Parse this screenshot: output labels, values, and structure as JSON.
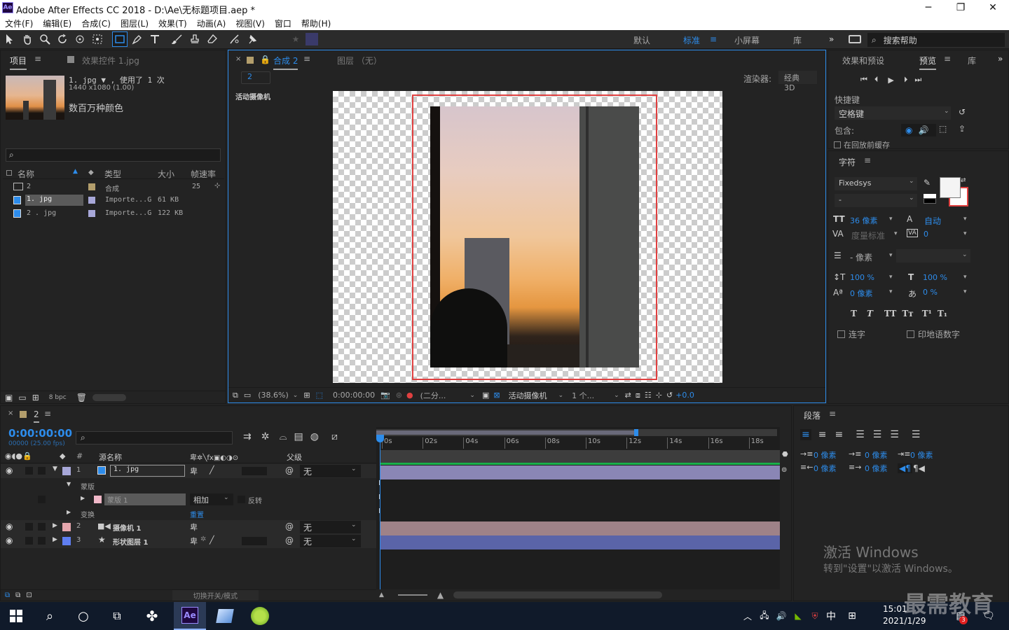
{
  "app": {
    "title": "Adobe After Effects CC 2018 - D:\\Ae\\无标题项目.aep *",
    "icon": "Ae"
  },
  "menu": [
    "文件(F)",
    "编辑(E)",
    "合成(C)",
    "图层(L)",
    "效果(T)",
    "动画(A)",
    "视图(V)",
    "窗口",
    "帮助(H)"
  ],
  "workspaces": {
    "default": "默认",
    "standard": "标准",
    "small": "小屏幕",
    "library": "库",
    "search_placeholder": "搜索帮助"
  },
  "project": {
    "tab": "项目",
    "effects_tab": "效果控件 1.jpg",
    "preview_name": "1. jpg ▼ , 使用了 1 次",
    "preview_dims": "1440 x1080 (1.00)",
    "preview_colors": "数百万种颜色",
    "columns": [
      "名称",
      "类型",
      "大小",
      "帧速率"
    ],
    "items": [
      {
        "name": "2",
        "type": "合成",
        "size": "",
        "fps": "25"
      },
      {
        "name": "1. jpg",
        "type": "Importe...G",
        "size": "61 KB",
        "fps": ""
      },
      {
        "name": "2 . jpg",
        "type": "Importe...G",
        "size": "122 KB",
        "fps": ""
      }
    ],
    "bpc": "8 bpc"
  },
  "comp": {
    "tab": "合成 2",
    "layer_tab": "图层 （无）",
    "sub_tab": "2",
    "renderer_label": "渲染器:",
    "renderer": "经典 3D",
    "camera_label": "活动摄像机",
    "zoom": "(38.6%)",
    "timecode": "0:00:00:00",
    "resolution": "(二分...",
    "view": "活动摄像机",
    "views": "1 个...",
    "exposure": "+0.0"
  },
  "preview_panel": {
    "tabs": [
      "效果和预设",
      "预览",
      "库"
    ],
    "shortcut_label": "快捷键",
    "shortcut": "空格键",
    "include_label": "包含:",
    "cache_label": "在回放前缓存"
  },
  "character": {
    "title": "字符",
    "font": "Fixedsys",
    "style": "-",
    "size": "36 像素",
    "leading": "自动",
    "kerning": "度量标准",
    "tracking": "0",
    "stroke": "- 像素",
    "vscale": "100 %",
    "hscale": "100 %",
    "baseline": "0 像素",
    "tsume": "0 %",
    "ligature": "连字",
    "hindi": "印地语数字"
  },
  "paragraph": {
    "title": "段落",
    "indent": "0 像素"
  },
  "timeline": {
    "tab": "2",
    "timecode": "0:00:00:00",
    "frames": "00000 (25.00 fps)",
    "col_source": "源名称",
    "col_parent": "父级",
    "ticks": [
      "0s",
      "02s",
      "04s",
      "06s",
      "08s",
      "10s",
      "12s",
      "14s",
      "16s",
      "18s"
    ],
    "layers": [
      {
        "num": "1",
        "name": "1. jpg",
        "parent": "无",
        "color": "#a7a7d8"
      },
      {
        "num": "2",
        "name": "摄像机 1",
        "parent": "无",
        "color": "#e5a6ad"
      },
      {
        "num": "3",
        "name": "形状图层 1",
        "parent": "无",
        "color": "#5f7ef0"
      }
    ],
    "mask_group": "蒙版",
    "mask_name": "蒙版 1",
    "mask_mode": "相加",
    "mask_invert": "反转",
    "transform": "变换",
    "reset": "重置",
    "toggle": "切换开关/模式"
  },
  "watermark": {
    "title": "激活 Windows",
    "sub": "转到\"设置\"以激活 Windows。",
    "brand": "最需教育"
  },
  "taskbar": {
    "time": "15:01",
    "date": "2021/1/29",
    "ime": "中",
    "badge": "3"
  }
}
